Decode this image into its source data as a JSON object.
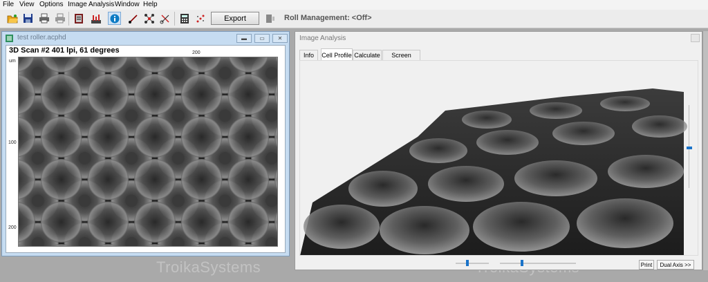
{
  "menu": [
    "File",
    "View",
    "Options",
    "Image Analysis",
    "Window",
    "Help"
  ],
  "toolbar": {
    "icons": [
      "open-folder-icon",
      "save-icon",
      "print-icon",
      "print-preview-icon",
      "book-icon",
      "chart-icon",
      "info-icon",
      "measure-icon",
      "nodes-icon",
      "cut-icon",
      "calculator-icon",
      "dots-icon",
      "panel-icon"
    ],
    "export_label": "Export",
    "roll_management": "Roll Management: <Off>"
  },
  "scan_window": {
    "title": "test roller.acphd",
    "scan_title": "3D Scan #2 401 lpi, 61 degrees",
    "x_tick": "200",
    "y_unit": "um",
    "y_ticks": [
      "100",
      "200"
    ]
  },
  "analysis_window": {
    "title": "Image Analysis",
    "tabs": [
      "Info",
      "Cell Profile",
      "Calculate",
      "Screen Count"
    ],
    "active_tab": "Cell Profile",
    "print_label": "Print",
    "dual_axis_label": "Dual Axis >>"
  },
  "watermark": "TroikaSystems",
  "colors": {
    "accent_slider": "#1a73c9",
    "mdi_title": "#c6dcf1",
    "workspace": "#a9a9a9"
  }
}
